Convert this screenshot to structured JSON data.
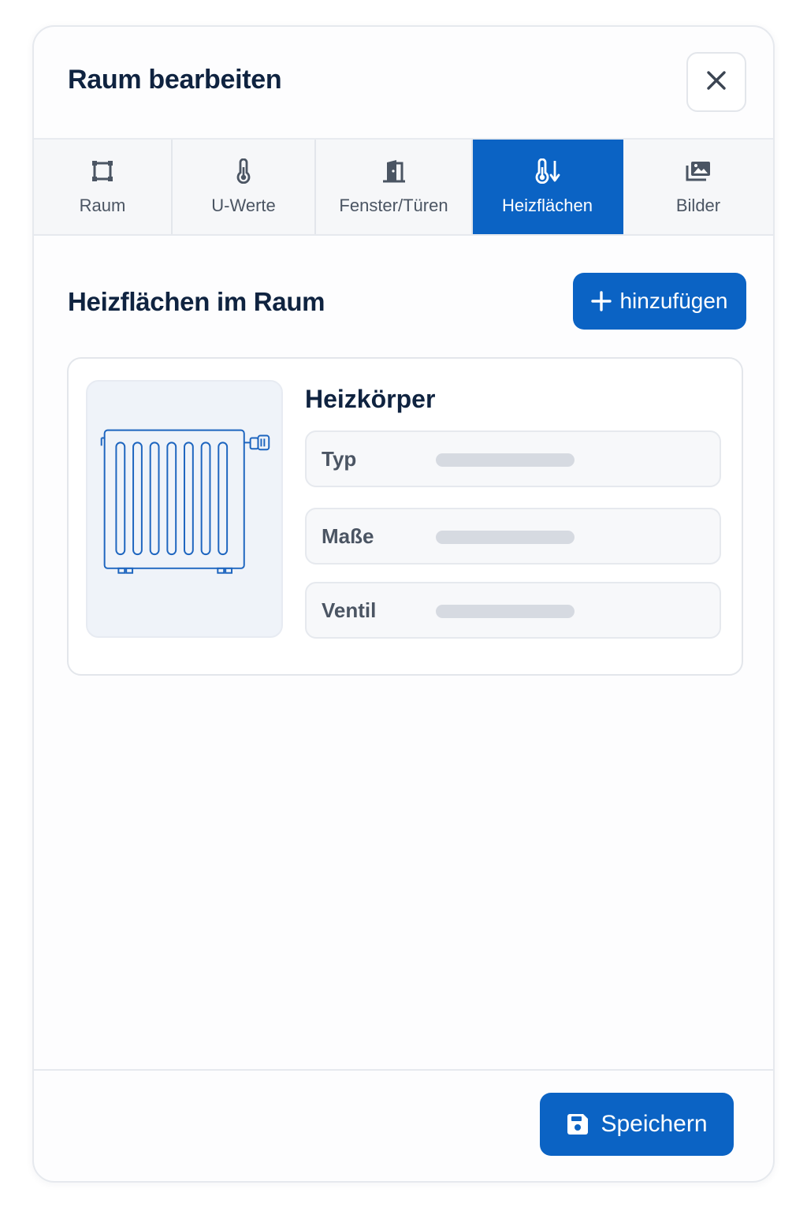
{
  "dialog": {
    "title": "Raum bearbeiten",
    "close_icon": "close-icon"
  },
  "tabs": [
    {
      "label": "Raum",
      "icon": "room-outline-icon",
      "active": false
    },
    {
      "label": "U-Werte",
      "icon": "thermometer-icon",
      "active": false
    },
    {
      "label": "Fenster/Türen",
      "icon": "door-icon",
      "active": false
    },
    {
      "label": "Heizflächen",
      "icon": "heating-thermometer-icon",
      "active": true
    },
    {
      "label": "Bilder",
      "icon": "images-icon",
      "active": false
    }
  ],
  "section": {
    "title": "Heizflächen im Raum",
    "add_label": "hinzufügen",
    "add_icon": "plus-icon"
  },
  "heating_card": {
    "title": "Heizkörper",
    "image_icon": "radiator-illustration",
    "fields": [
      {
        "label": "Typ"
      },
      {
        "label": "Maße"
      },
      {
        "label": "Ventil"
      }
    ]
  },
  "footer": {
    "save_label": "Speichern",
    "save_icon": "floppy-disk-icon"
  },
  "colors": {
    "accent": "#0b63c4",
    "text_dark": "#0f2340",
    "text_muted": "#4b5563",
    "placeholder_bar": "#d6dae1"
  }
}
